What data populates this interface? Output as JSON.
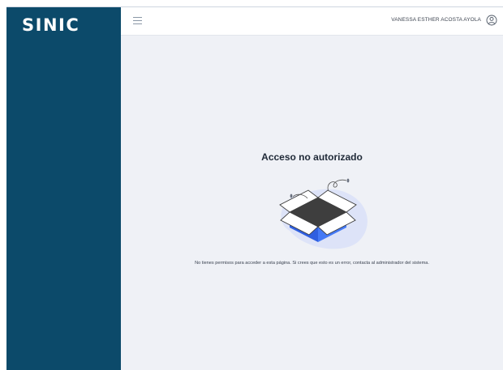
{
  "app": {
    "logo_text": "SINIC"
  },
  "header": {
    "user_name": "VANESSA ESTHER ACOSTA AYOLA"
  },
  "main": {
    "title": "Acceso no autorizado",
    "message": "No tienes permisos para acceder a esta página. Si crees que esto es un error, contacta al administrador del sistema."
  },
  "colors": {
    "sidebar": "#0c4a6a",
    "background": "#eff1f6",
    "box_blue": "#3b6ff0",
    "box_dark": "#3e3e3e"
  },
  "icons": {
    "menu": "hamburger-menu-icon",
    "user": "user-circle-icon",
    "illustration": "empty-box-illustration"
  }
}
